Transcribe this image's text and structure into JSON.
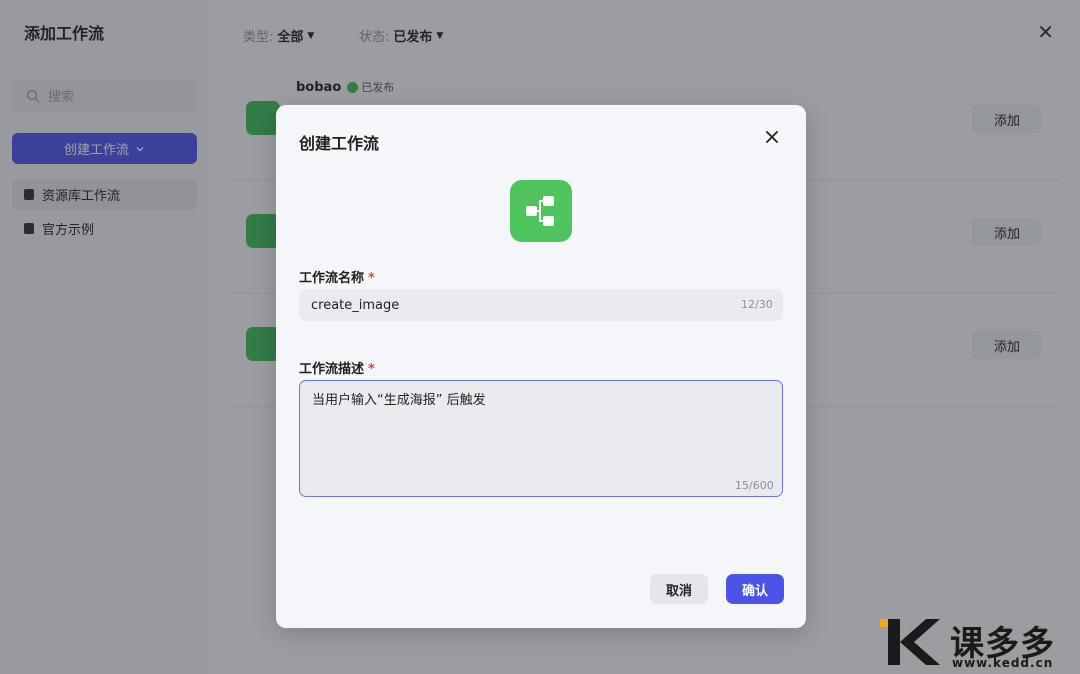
{
  "sidebar": {
    "title": "添加工作流",
    "search_placeholder": "搜索",
    "create_button": "创建工作流",
    "nav": [
      {
        "label": "资源库工作流"
      },
      {
        "label": "官方示例"
      }
    ]
  },
  "filters": {
    "type_label": "类型:",
    "type_value": "全部",
    "status_label": "状态:",
    "status_value": "已发布"
  },
  "list": {
    "rows": [
      {
        "name": "bobao",
        "status": "已发布",
        "action": "添加"
      },
      {
        "name": "",
        "status": "",
        "action": "添加"
      },
      {
        "name": "",
        "status": "",
        "action": "添加"
      }
    ]
  },
  "modal": {
    "title": "创建工作流",
    "name_label": "工作流名称",
    "name_value": "create_image",
    "name_counter": "12/30",
    "desc_label": "工作流描述",
    "desc_value": "当用户输入“生成海报” 后触发",
    "desc_counter": "15/600",
    "cancel": "取消",
    "confirm": "确认",
    "required_mark": "*"
  },
  "watermark": {
    "brand": "课多多",
    "url": "www.kedd.cn"
  },
  "colors": {
    "accent": "#4d53e8",
    "workflow_green": "#4ec35e",
    "required_red": "#e0443c"
  }
}
